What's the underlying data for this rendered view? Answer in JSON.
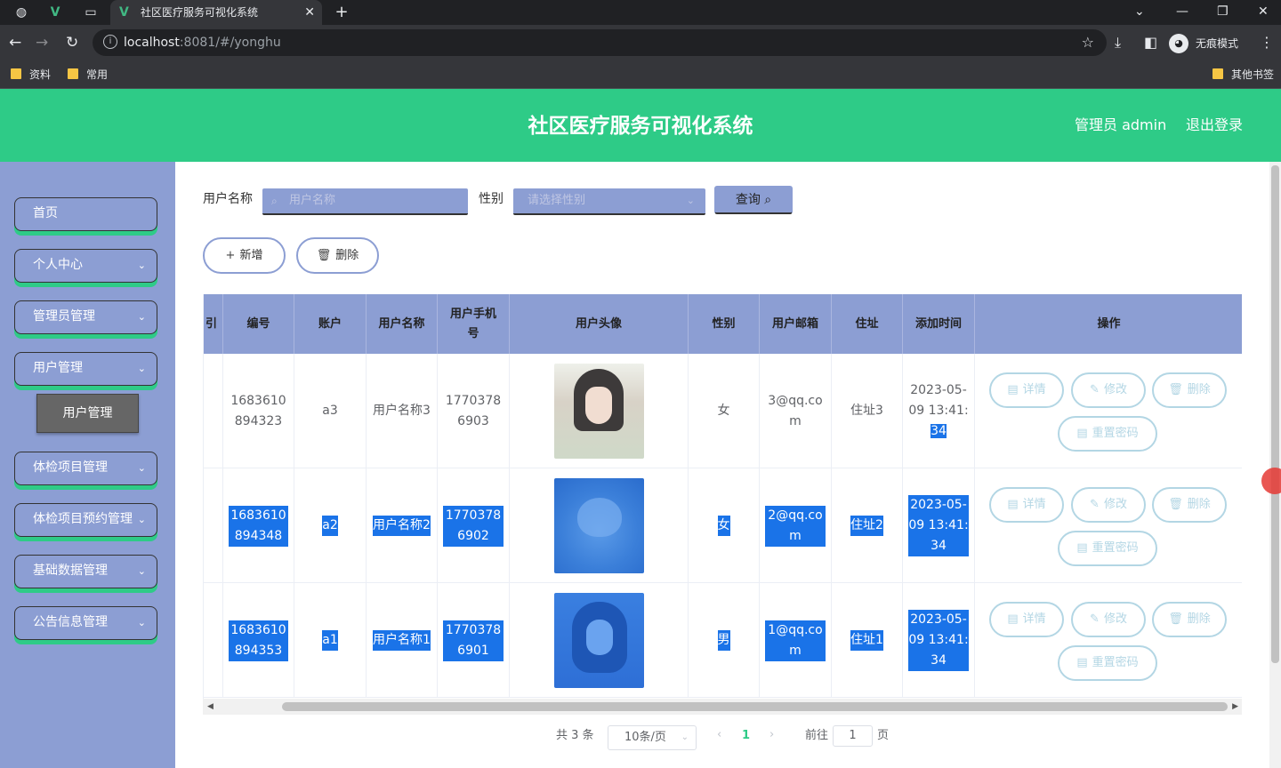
{
  "browser": {
    "tab_title": "社区医疗服务可视化系统",
    "url_host": "localhost",
    "url_rest": ":8081/#/yonghu",
    "incognito_label": "无痕模式",
    "bookmarks": [
      "资料",
      "常用"
    ],
    "other_bookmarks": "其他书签"
  },
  "header": {
    "title": "社区医疗服务可视化系统",
    "admin": "管理员 admin",
    "logout": "退出登录"
  },
  "sidebar": {
    "items": [
      {
        "label": "首页"
      },
      {
        "label": "个人中心"
      },
      {
        "label": "管理员管理"
      },
      {
        "label": "用户管理"
      },
      {
        "label": "体检项目管理"
      },
      {
        "label": "体检项目预约管理"
      },
      {
        "label": "基础数据管理"
      },
      {
        "label": "公告信息管理"
      }
    ],
    "sub_item": "用户管理"
  },
  "search": {
    "name_label": "用户名称",
    "name_placeholder": "用户名称",
    "gender_label": "性别",
    "gender_placeholder": "请选择性别",
    "query_label": "查询"
  },
  "actions": {
    "add_label": "新增",
    "delete_label": "删除"
  },
  "table": {
    "columns": [
      "引",
      "编号",
      "账户",
      "用户名称",
      "用户手机号",
      "用户头像",
      "性别",
      "用户邮箱",
      "住址",
      "添加时间",
      "操作"
    ],
    "rows": [
      {
        "id": "1683610894323",
        "account": "a3",
        "name": "用户名称3",
        "phone": "17703786903",
        "gender": "女",
        "email": "3@qq.com",
        "address": "住址3",
        "time_a": "2023-05-09 13:4",
        "time_b": "1:",
        "time_c": "34",
        "selected": false
      },
      {
        "id": "1683610894348",
        "account": "a2",
        "name": "用户名称2",
        "phone": "17703786902",
        "gender": "女",
        "email": "2@qq.com",
        "address": "住址2",
        "time": "2023-05-09 13:41:34",
        "selected": true
      },
      {
        "id": "1683610894353",
        "account": "a1",
        "name": "用户名称1",
        "phone": "17703786901",
        "gender": "男",
        "email": "1@qq.com",
        "address": "住址1",
        "time": "2023-05-09 13:41:34",
        "selected": true
      }
    ],
    "ops": {
      "detail": "详情",
      "edit": "修改",
      "delete": "删除",
      "reset": "重置密码"
    }
  },
  "pagination": {
    "total": "共 3 条",
    "page_size": "10条/页",
    "current": "1",
    "goto_label": "前往",
    "goto_value": "1",
    "unit": "页"
  }
}
